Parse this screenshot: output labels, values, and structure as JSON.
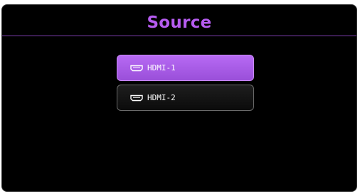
{
  "dialog": {
    "title": "Source"
  },
  "sources": [
    {
      "label": "HDMI-1",
      "icon": "hdmi-port-icon",
      "selected": true
    },
    {
      "label": "HDMI-2",
      "icon": "hdmi-port-icon",
      "selected": false
    }
  ],
  "colors": {
    "accent": "#b65cf0",
    "selected_bg": "#a95ce8",
    "background": "#000000"
  }
}
